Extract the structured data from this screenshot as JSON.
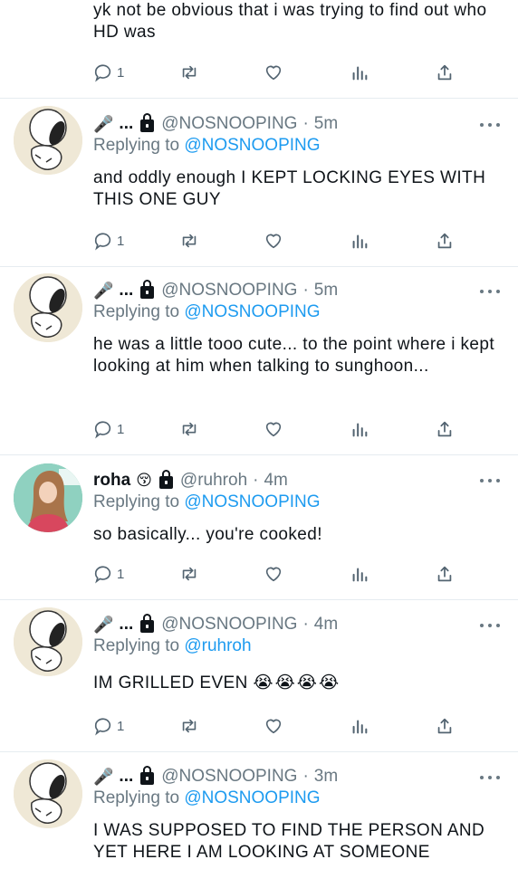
{
  "top_partial": {
    "text": "yk not be obvious that i was trying to find out who HD was",
    "reply_count": "1"
  },
  "tweets": [
    {
      "display_name": "...",
      "mic_icon": "🎤",
      "handle": "@NOSNOOPING",
      "time": "5m",
      "replying_prefix": "Replying to",
      "replying_to": "@NOSNOOPING",
      "text": "and oddly enough I KEPT LOCKING EYES WITH THIS ONE GUY",
      "reply_count": "1"
    },
    {
      "display_name": "...",
      "mic_icon": "🎤",
      "handle": "@NOSNOOPING",
      "time": "5m",
      "replying_prefix": "Replying to",
      "replying_to": "@NOSNOOPING",
      "text": "he was a little tooo cute... to the point where i kept looking at him when talking to sunghoon...",
      "reply_count": "1"
    },
    {
      "display_name": "roha",
      "name_emoji": "😚",
      "handle": "@ruhroh",
      "time": "4m",
      "replying_prefix": "Replying to",
      "replying_to": "@NOSNOOPING",
      "text": "so basically... you're cooked!",
      "reply_count": "1"
    },
    {
      "display_name": "...",
      "mic_icon": "🎤",
      "handle": "@NOSNOOPING",
      "time": "4m",
      "replying_prefix": "Replying to",
      "replying_to": "@ruhroh",
      "text": "IM GRILLED EVEN",
      "emojis": "😭😭😭😭",
      "reply_count": "1"
    },
    {
      "display_name": "...",
      "mic_icon": "🎤",
      "handle": "@NOSNOOPING",
      "time": "3m",
      "replying_prefix": "Replying to",
      "replying_to": "@NOSNOOPING",
      "text": "I WAS SUPPOSED TO FIND THE PERSON AND YET HERE I AM LOOKING AT SOMEONE"
    }
  ],
  "colors": {
    "link": "#1d9bf0",
    "secondary_text": "#697882",
    "primary_text": "#0f1419",
    "divider": "#e6ecf0"
  },
  "icons": {
    "reply": "reply-icon",
    "retweet": "retweet-icon",
    "like": "heart-icon",
    "views": "views-icon",
    "share": "share-icon",
    "more": "more-icon",
    "lock": "lock-icon"
  }
}
